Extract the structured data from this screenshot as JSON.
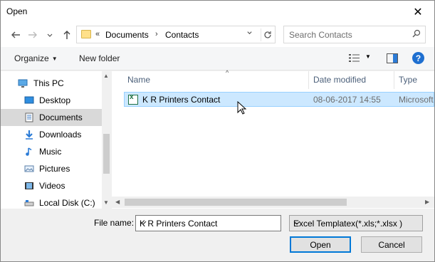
{
  "window": {
    "title": "Open",
    "close_glyph": "✕"
  },
  "nav": {
    "back_icon": "arrow-left-icon",
    "forward_icon": "arrow-right-icon",
    "recent_icon": "chevron-down-icon",
    "up_icon": "arrow-up-icon"
  },
  "address": {
    "prefix": "«",
    "segments": [
      "Documents",
      "Contacts"
    ],
    "separator": "›"
  },
  "search": {
    "placeholder": "Search Contacts"
  },
  "toolbar": {
    "organize_label": "Organize",
    "new_folder_label": "New folder",
    "help_label": "?"
  },
  "navpane": {
    "items": [
      {
        "label": "This PC",
        "icon": "pc-icon"
      },
      {
        "label": "Desktop",
        "icon": "desktop-icon"
      },
      {
        "label": "Documents",
        "icon": "documents-icon",
        "selected": true
      },
      {
        "label": "Downloads",
        "icon": "download-icon"
      },
      {
        "label": "Music",
        "icon": "music-icon"
      },
      {
        "label": "Pictures",
        "icon": "pictures-icon"
      },
      {
        "label": "Videos",
        "icon": "videos-icon"
      },
      {
        "label": "Local Disk (C:)",
        "icon": "disk-icon"
      }
    ]
  },
  "filelist": {
    "columns": [
      "Name",
      "Date modified",
      "Type"
    ],
    "rows": [
      {
        "name": "K R Printers Contact",
        "date": "08-06-2017 14:55",
        "type": "Microsoft",
        "icon": "excel-file-icon",
        "selected": true
      }
    ]
  },
  "footer": {
    "filename_label": "File name:",
    "filename_value": "K R Printers Contact",
    "filter_value": "Excel Templatex(*.xls;*.xlsx )",
    "open_label": "Open",
    "cancel_label": "Cancel"
  },
  "colors": {
    "selection": "#cce8ff",
    "accent": "#0078d7",
    "help": "#1e6fd0"
  }
}
